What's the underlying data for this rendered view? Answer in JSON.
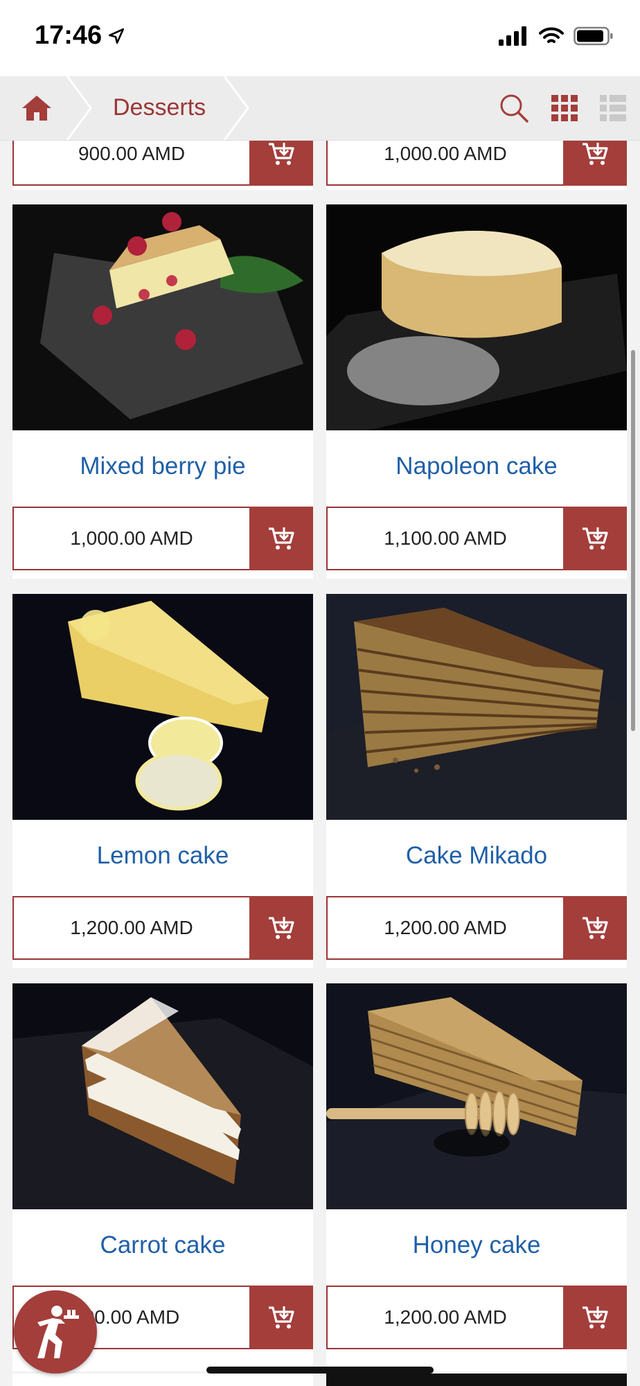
{
  "status_bar": {
    "time": "17:46"
  },
  "nav": {
    "breadcrumb": "Desserts"
  },
  "top_partial": [
    {
      "price": "900.00 AMD"
    },
    {
      "price": "1,000.00 AMD"
    }
  ],
  "products": [
    {
      "name": "Mixed berry pie",
      "price": "1,000.00 AMD"
    },
    {
      "name": "Napoleon cake",
      "price": "1,100.00 AMD"
    },
    {
      "name": "Lemon cake",
      "price": "1,200.00 AMD"
    },
    {
      "name": "Cake Mikado",
      "price": "1,200.00 AMD"
    },
    {
      "name": "Carrot cake",
      "price": "00.00 AMD"
    },
    {
      "name": "Honey cake",
      "price": "1,200.00 AMD"
    }
  ],
  "colors": {
    "accent": "#a33e3b",
    "link": "#1f5fa8",
    "nav_bg": "#ececec"
  },
  "icons": [
    "location-arrow-icon",
    "signal-icon",
    "wifi-icon",
    "battery-icon",
    "home-icon",
    "search-icon",
    "grid-view-icon",
    "list-view-icon",
    "add-to-cart-icon",
    "waiter-icon"
  ]
}
